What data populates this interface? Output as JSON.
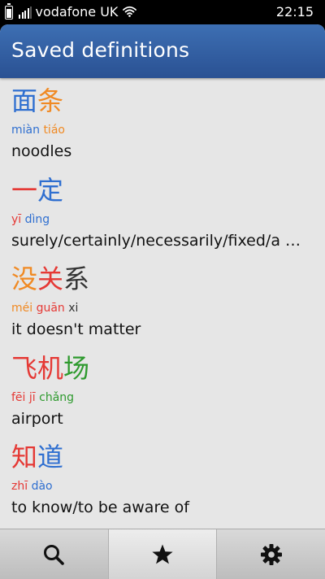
{
  "status_bar": {
    "carrier": "vodafone UK",
    "time": "22:15",
    "battery_level": 0.7,
    "signal_bars": 4
  },
  "header": {
    "title": "Saved definitions"
  },
  "tone_colors": {
    "1": "#e53935",
    "2": "#f08a24",
    "3": "#2e9a2e",
    "4": "#2f6fd0",
    "5": "#333333"
  },
  "entries": [
    {
      "chars": [
        {
          "c": "面",
          "tone": 4
        },
        {
          "c": "条",
          "tone": 2
        }
      ],
      "pinyin": [
        {
          "p": "miàn",
          "tone": 4
        },
        {
          "p": "tiáo",
          "tone": 2
        }
      ],
      "definition": "noodles"
    },
    {
      "chars": [
        {
          "c": "一",
          "tone": 1
        },
        {
          "c": "定",
          "tone": 4
        }
      ],
      "pinyin": [
        {
          "p": "yī",
          "tone": 1
        },
        {
          "p": "dìng",
          "tone": 4
        }
      ],
      "definition": "surely/certainly/necessarily/fixed/a …"
    },
    {
      "chars": [
        {
          "c": "没",
          "tone": 2
        },
        {
          "c": "关",
          "tone": 1
        },
        {
          "c": "系",
          "tone": 5
        }
      ],
      "pinyin": [
        {
          "p": "méi",
          "tone": 2
        },
        {
          "p": "guān",
          "tone": 1
        },
        {
          "p": "xi",
          "tone": 5
        }
      ],
      "definition": "it doesn't matter"
    },
    {
      "chars": [
        {
          "c": "飞",
          "tone": 1
        },
        {
          "c": "机",
          "tone": 1
        },
        {
          "c": "场",
          "tone": 3
        }
      ],
      "pinyin": [
        {
          "p": "fēi",
          "tone": 1
        },
        {
          "p": "jī",
          "tone": 1
        },
        {
          "p": "chǎng",
          "tone": 3
        }
      ],
      "definition": "airport"
    },
    {
      "chars": [
        {
          "c": "知",
          "tone": 1
        },
        {
          "c": "道",
          "tone": 4
        }
      ],
      "pinyin": [
        {
          "p": "zhī",
          "tone": 1
        },
        {
          "p": "dào",
          "tone": 4
        }
      ],
      "definition": "to know/to be aware of"
    }
  ],
  "toolbar": {
    "items": [
      {
        "icon": "search-icon",
        "active": false
      },
      {
        "icon": "star-icon",
        "active": true
      },
      {
        "icon": "gear-icon",
        "active": false
      }
    ]
  }
}
